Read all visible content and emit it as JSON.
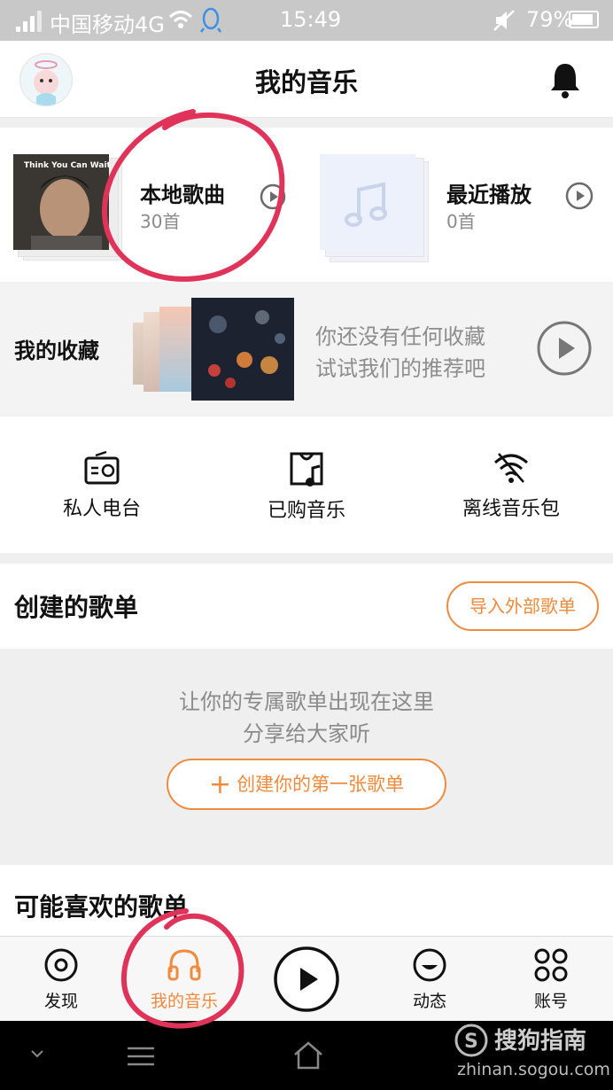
{
  "status_bar": {
    "carrier": "中国移动4G",
    "time": "15:49",
    "battery": "79%"
  },
  "header": {
    "title": "我的音乐"
  },
  "local_songs": {
    "cover_text": "Think You Can Wait",
    "title": "本地歌曲",
    "count": "30首"
  },
  "recent": {
    "title": "最近播放",
    "count": "0首"
  },
  "favorites": {
    "title": "我的收藏",
    "tip_line1": "你还没有任何收藏",
    "tip_line2": "试试我们的推荐吧"
  },
  "quick_actions": [
    {
      "label": "私人电台",
      "icon": "radio-icon"
    },
    {
      "label": "已购音乐",
      "icon": "purchased-music-icon"
    },
    {
      "label": "离线音乐包",
      "icon": "offline-wifi-icon"
    }
  ],
  "created_playlists": {
    "title": "创建的歌单",
    "import_button": "导入外部歌单",
    "empty_line1": "让你的专属歌单出现在这里",
    "empty_line2": "分享给大家听",
    "create_button": "创建你的第一张歌单"
  },
  "recommended": {
    "title": "可能喜欢的歌单"
  },
  "tabs": [
    {
      "label": "发现",
      "icon": "discover-icon"
    },
    {
      "label": "我的音乐",
      "icon": "headphones-icon",
      "active": true
    },
    {
      "label": "",
      "icon": "play-icon"
    },
    {
      "label": "动态",
      "icon": "feed-icon"
    },
    {
      "label": "账号",
      "icon": "grid-icon"
    }
  ],
  "watermark": {
    "name": "搜狗指南",
    "url": "zhinan.sogou.com"
  },
  "colors": {
    "accent": "#f08a3c",
    "annotation": "#e0335a"
  }
}
